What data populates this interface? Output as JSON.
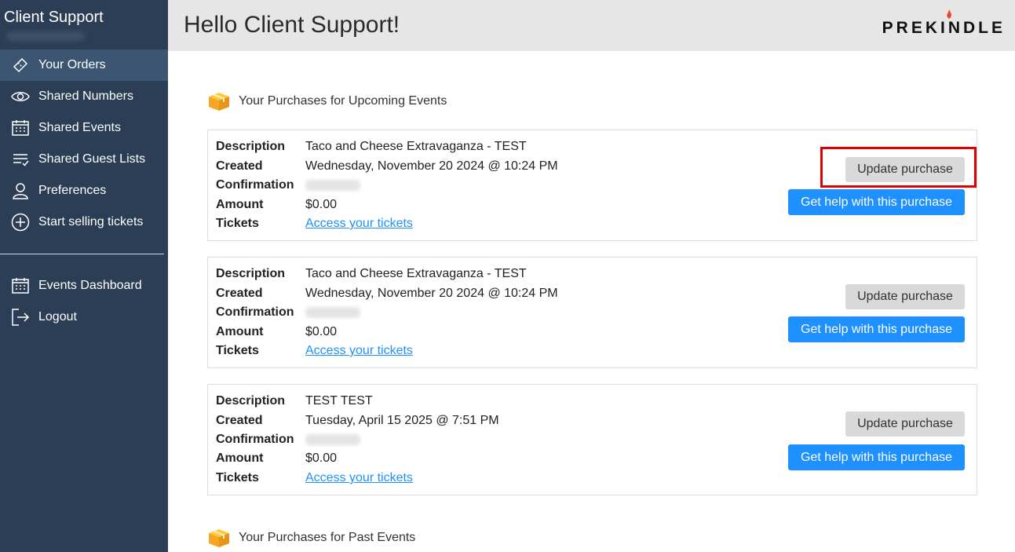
{
  "sidebar": {
    "title": "Client Support",
    "items": [
      {
        "label": "Your Orders",
        "icon": "ticket-icon"
      },
      {
        "label": "Shared Numbers",
        "icon": "eye-icon"
      },
      {
        "label": "Shared Events",
        "icon": "calendar-icon"
      },
      {
        "label": "Shared Guest Lists",
        "icon": "list-check-icon"
      },
      {
        "label": "Preferences",
        "icon": "user-icon"
      },
      {
        "label": "Start selling tickets",
        "icon": "plus-circle-icon"
      }
    ],
    "secondary_items": [
      {
        "label": "Events Dashboard",
        "icon": "calendar-icon"
      },
      {
        "label": "Logout",
        "icon": "logout-icon"
      }
    ]
  },
  "header": {
    "title": "Hello Client Support!",
    "logo": "PREKINDLE"
  },
  "sections": {
    "upcoming_title": "Your Purchases for Upcoming Events",
    "past_title": "Your Purchases for Past Events"
  },
  "labels": {
    "description": "Description",
    "created": "Created",
    "confirmation": "Confirmation",
    "amount": "Amount",
    "tickets": "Tickets"
  },
  "purchases": [
    {
      "description": "Taco and Cheese Extravaganza - TEST",
      "created": "Wednesday, November 20 2024 @ 10:24 PM",
      "amount": "$0.00",
      "tickets_link": "Access your tickets",
      "update_label": "Update purchase",
      "help_label": "Get help with this purchase"
    },
    {
      "description": "Taco and Cheese Extravaganza - TEST",
      "created": "Wednesday, November 20 2024 @ 10:24 PM",
      "amount": "$0.00",
      "tickets_link": "Access your tickets",
      "update_label": "Update purchase",
      "help_label": "Get help with this purchase"
    },
    {
      "description": "TEST TEST",
      "created": "Tuesday, April 15 2025 @ 7:51 PM",
      "amount": "$0.00",
      "tickets_link": "Access your tickets",
      "update_label": "Update purchase",
      "help_label": "Get help with this purchase"
    }
  ],
  "colors": {
    "sidebar_bg": "#2c3e55",
    "accent": "#1e90ff",
    "highlight": "#e00000"
  }
}
